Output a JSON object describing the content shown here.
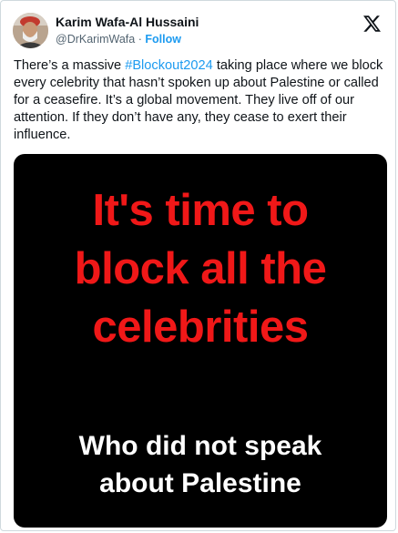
{
  "author": {
    "name": "Karim Wafa-Al Hussaini",
    "handle": "@DrKarimWafa",
    "separator": "·",
    "follow_label": "Follow"
  },
  "tweet": {
    "text_before": "There’s a massive ",
    "hashtag": "#Blockout2024",
    "text_after": " taking place where we block every celebrity that hasn’t spoken up about Palestine or called for a ceasefire. It’s a global movement. They live off of our attention. If they don’t have any, they cease to exert their influence."
  },
  "media": {
    "headline_lines": [
      "It's time to",
      "block all the",
      "celebrities"
    ],
    "subline_lines": [
      "Who did not speak",
      "about Palestine"
    ]
  },
  "icons": {
    "logo": "x-logo-icon",
    "avatar": "avatar-photo"
  },
  "colors": {
    "link": "#1d9bf0",
    "headline": "#f01818",
    "text": "#0f1419",
    "muted": "#536471"
  }
}
